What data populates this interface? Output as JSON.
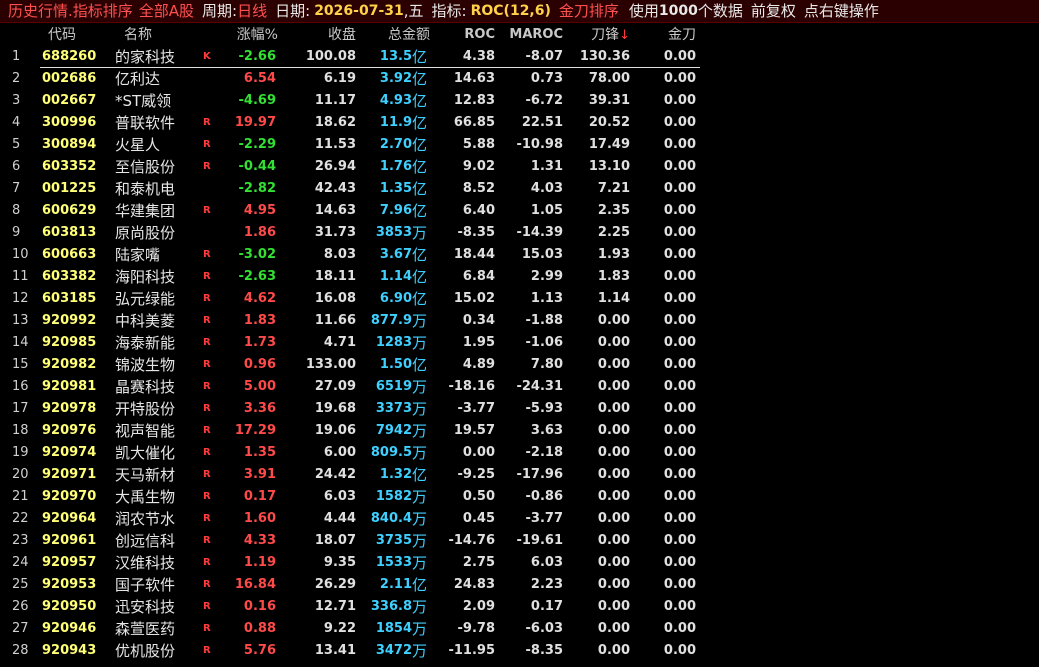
{
  "titlebar": {
    "view": "历史行情.指标排序",
    "market": "全部A股",
    "period_label": "周期:",
    "period_value": "日线",
    "date_label": "日期:",
    "date_value": "2026-07-31",
    "date_suffix": ",五",
    "indicator_label": "指标:",
    "indicator_value": "ROC(12,6)",
    "sort_mode": "金刀排序",
    "use_prefix": "使用",
    "use_count": "1000",
    "use_suffix": "个数据",
    "adjust": "前复权",
    "hint": "点右键操作"
  },
  "columns": {
    "code": "代码",
    "name": "名称",
    "change": "涨幅%",
    "close": "收盘",
    "amount": "总金额",
    "roc": "ROC",
    "maroc": "MAROC",
    "daofeng": "刀锋",
    "sort_arrow": "↓",
    "jindao": "金刀"
  },
  "colors": {
    "up": "#ff4a4a",
    "down": "#33e033",
    "code": "#ffff78",
    "amount": "#3fd0ff",
    "title_bg": "#2a0000"
  },
  "rows": [
    {
      "idx": "1",
      "code": "688260",
      "name": "的家科技",
      "flag": "K",
      "chg": "-2.66",
      "close": "100.08",
      "amt": "13.5",
      "unit": "亿",
      "roc": "4.38",
      "maroc": "-8.07",
      "dao": "130.36",
      "jin": "0.00"
    },
    {
      "idx": "2",
      "code": "002686",
      "name": "亿利达",
      "flag": "",
      "chg": "6.54",
      "close": "6.19",
      "amt": "3.92",
      "unit": "亿",
      "roc": "14.63",
      "maroc": "0.73",
      "dao": "78.00",
      "jin": "0.00"
    },
    {
      "idx": "3",
      "code": "002667",
      "name": "*ST威领",
      "flag": "",
      "chg": "-4.69",
      "close": "11.17",
      "amt": "4.93",
      "unit": "亿",
      "roc": "12.83",
      "maroc": "-6.72",
      "dao": "39.31",
      "jin": "0.00"
    },
    {
      "idx": "4",
      "code": "300996",
      "name": "普联软件",
      "flag": "R",
      "chg": "19.97",
      "close": "18.62",
      "amt": "11.9",
      "unit": "亿",
      "roc": "66.85",
      "maroc": "22.51",
      "dao": "20.52",
      "jin": "0.00"
    },
    {
      "idx": "5",
      "code": "300894",
      "name": "火星人",
      "flag": "R",
      "chg": "-2.29",
      "close": "11.53",
      "amt": "2.70",
      "unit": "亿",
      "roc": "5.88",
      "maroc": "-10.98",
      "dao": "17.49",
      "jin": "0.00"
    },
    {
      "idx": "6",
      "code": "603352",
      "name": "至信股份",
      "flag": "R",
      "chg": "-0.44",
      "close": "26.94",
      "amt": "1.76",
      "unit": "亿",
      "roc": "9.02",
      "maroc": "1.31",
      "dao": "13.10",
      "jin": "0.00"
    },
    {
      "idx": "7",
      "code": "001225",
      "name": "和泰机电",
      "flag": "",
      "chg": "-2.82",
      "close": "42.43",
      "amt": "1.35",
      "unit": "亿",
      "roc": "8.52",
      "maroc": "4.03",
      "dao": "7.21",
      "jin": "0.00"
    },
    {
      "idx": "8",
      "code": "600629",
      "name": "华建集团",
      "flag": "R",
      "chg": "4.95",
      "close": "14.63",
      "amt": "7.96",
      "unit": "亿",
      "roc": "6.40",
      "maroc": "1.05",
      "dao": "2.35",
      "jin": "0.00"
    },
    {
      "idx": "9",
      "code": "603813",
      "name": "原尚股份",
      "flag": "",
      "chg": "1.86",
      "close": "31.73",
      "amt": "3853",
      "unit": "万",
      "roc": "-8.35",
      "maroc": "-14.39",
      "dao": "2.25",
      "jin": "0.00"
    },
    {
      "idx": "10",
      "code": "600663",
      "name": "陆家嘴",
      "flag": "R",
      "chg": "-3.02",
      "close": "8.03",
      "amt": "3.67",
      "unit": "亿",
      "roc": "18.44",
      "maroc": "15.03",
      "dao": "1.93",
      "jin": "0.00"
    },
    {
      "idx": "11",
      "code": "603382",
      "name": "海阳科技",
      "flag": "R",
      "chg": "-2.63",
      "close": "18.11",
      "amt": "1.14",
      "unit": "亿",
      "roc": "6.84",
      "maroc": "2.99",
      "dao": "1.83",
      "jin": "0.00"
    },
    {
      "idx": "12",
      "code": "603185",
      "name": "弘元绿能",
      "flag": "R",
      "chg": "4.62",
      "close": "16.08",
      "amt": "6.90",
      "unit": "亿",
      "roc": "15.02",
      "maroc": "1.13",
      "dao": "1.14",
      "jin": "0.00"
    },
    {
      "idx": "13",
      "code": "920992",
      "name": "中科美菱",
      "flag": "R",
      "chg": "1.83",
      "close": "11.66",
      "amt": "877.9",
      "unit": "万",
      "roc": "0.34",
      "maroc": "-1.88",
      "dao": "0.00",
      "jin": "0.00"
    },
    {
      "idx": "14",
      "code": "920985",
      "name": "海泰新能",
      "flag": "R",
      "chg": "1.73",
      "close": "4.71",
      "amt": "1283",
      "unit": "万",
      "roc": "1.95",
      "maroc": "-1.06",
      "dao": "0.00",
      "jin": "0.00"
    },
    {
      "idx": "15",
      "code": "920982",
      "name": "锦波生物",
      "flag": "R",
      "chg": "0.96",
      "close": "133.00",
      "amt": "1.50",
      "unit": "亿",
      "roc": "4.89",
      "maroc": "7.80",
      "dao": "0.00",
      "jin": "0.00"
    },
    {
      "idx": "16",
      "code": "920981",
      "name": "晶赛科技",
      "flag": "R",
      "chg": "5.00",
      "close": "27.09",
      "amt": "6519",
      "unit": "万",
      "roc": "-18.16",
      "maroc": "-24.31",
      "dao": "0.00",
      "jin": "0.00"
    },
    {
      "idx": "17",
      "code": "920978",
      "name": "开特股份",
      "flag": "R",
      "chg": "3.36",
      "close": "19.68",
      "amt": "3373",
      "unit": "万",
      "roc": "-3.77",
      "maroc": "-5.93",
      "dao": "0.00",
      "jin": "0.00"
    },
    {
      "idx": "18",
      "code": "920976",
      "name": "视声智能",
      "flag": "R",
      "chg": "17.29",
      "close": "19.06",
      "amt": "7942",
      "unit": "万",
      "roc": "19.57",
      "maroc": "3.63",
      "dao": "0.00",
      "jin": "0.00"
    },
    {
      "idx": "19",
      "code": "920974",
      "name": "凯大催化",
      "flag": "R",
      "chg": "1.35",
      "close": "6.00",
      "amt": "809.5",
      "unit": "万",
      "roc": "0.00",
      "maroc": "-2.18",
      "dao": "0.00",
      "jin": "0.00"
    },
    {
      "idx": "20",
      "code": "920971",
      "name": "天马新材",
      "flag": "R",
      "chg": "3.91",
      "close": "24.42",
      "amt": "1.32",
      "unit": "亿",
      "roc": "-9.25",
      "maroc": "-17.96",
      "dao": "0.00",
      "jin": "0.00"
    },
    {
      "idx": "21",
      "code": "920970",
      "name": "大禹生物",
      "flag": "R",
      "chg": "0.17",
      "close": "6.03",
      "amt": "1582",
      "unit": "万",
      "roc": "0.50",
      "maroc": "-0.86",
      "dao": "0.00",
      "jin": "0.00"
    },
    {
      "idx": "22",
      "code": "920964",
      "name": "润农节水",
      "flag": "R",
      "chg": "1.60",
      "close": "4.44",
      "amt": "840.4",
      "unit": "万",
      "roc": "0.45",
      "maroc": "-3.77",
      "dao": "0.00",
      "jin": "0.00"
    },
    {
      "idx": "23",
      "code": "920961",
      "name": "创远信科",
      "flag": "R",
      "chg": "4.33",
      "close": "18.07",
      "amt": "3735",
      "unit": "万",
      "roc": "-14.76",
      "maroc": "-19.61",
      "dao": "0.00",
      "jin": "0.00"
    },
    {
      "idx": "24",
      "code": "920957",
      "name": "汉维科技",
      "flag": "R",
      "chg": "1.19",
      "close": "9.35",
      "amt": "1533",
      "unit": "万",
      "roc": "2.75",
      "maroc": "6.03",
      "dao": "0.00",
      "jin": "0.00"
    },
    {
      "idx": "25",
      "code": "920953",
      "name": "国子软件",
      "flag": "R",
      "chg": "16.84",
      "close": "26.29",
      "amt": "2.11",
      "unit": "亿",
      "roc": "24.83",
      "maroc": "2.23",
      "dao": "0.00",
      "jin": "0.00"
    },
    {
      "idx": "26",
      "code": "920950",
      "name": "迅安科技",
      "flag": "R",
      "chg": "0.16",
      "close": "12.71",
      "amt": "336.8",
      "unit": "万",
      "roc": "2.09",
      "maroc": "0.17",
      "dao": "0.00",
      "jin": "0.00"
    },
    {
      "idx": "27",
      "code": "920946",
      "name": "森萱医药",
      "flag": "R",
      "chg": "0.88",
      "close": "9.22",
      "amt": "1854",
      "unit": "万",
      "roc": "-9.78",
      "maroc": "-6.03",
      "dao": "0.00",
      "jin": "0.00"
    },
    {
      "idx": "28",
      "code": "920943",
      "name": "优机股份",
      "flag": "R",
      "chg": "5.76",
      "close": "13.41",
      "amt": "3472",
      "unit": "万",
      "roc": "-11.95",
      "maroc": "-8.35",
      "dao": "0.00",
      "jin": "0.00"
    }
  ]
}
